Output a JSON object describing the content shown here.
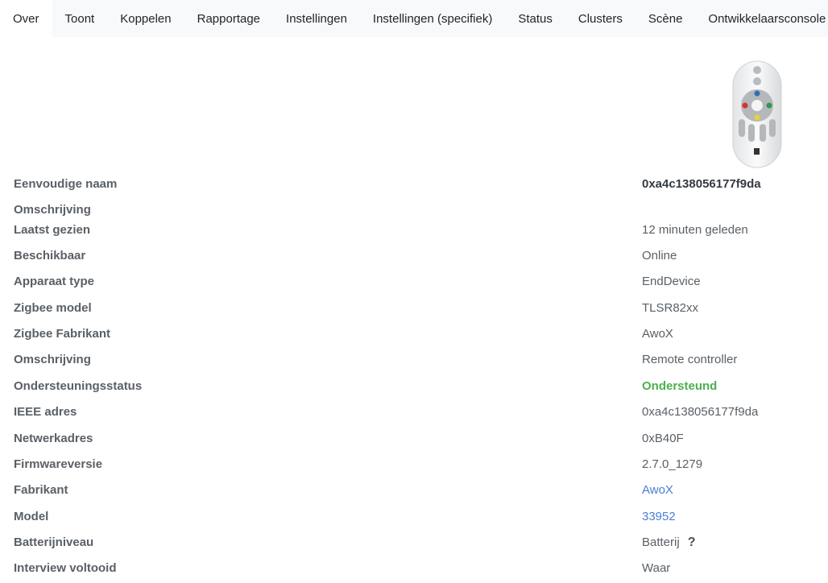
{
  "tabs": [
    {
      "label": "Over"
    },
    {
      "label": "Toont"
    },
    {
      "label": "Koppelen"
    },
    {
      "label": "Rapportage"
    },
    {
      "label": "Instellingen"
    },
    {
      "label": "Instellingen (specifiek)"
    },
    {
      "label": "Status"
    },
    {
      "label": "Clusters"
    },
    {
      "label": "Scène"
    },
    {
      "label": "Ontwikkelaarsconsole"
    }
  ],
  "details": {
    "friendly_name_label": "Eenvoudige naam",
    "friendly_name_value": "0xa4c138056177f9da",
    "description_label": "Omschrijving",
    "last_seen_label": "Laatst gezien",
    "last_seen_value": "12 minuten geleden",
    "availability_label": "Beschikbaar",
    "availability_value": "Online",
    "device_type_label": "Apparaat type",
    "device_type_value": "EndDevice",
    "zigbee_model_label": "Zigbee model",
    "zigbee_model_value": "TLSR82xx",
    "zigbee_manufacturer_label": "Zigbee Fabrikant",
    "zigbee_manufacturer_value": "AwoX",
    "description2_label": "Omschrijving",
    "description2_value": "Remote controller",
    "support_status_label": "Ondersteuningsstatus",
    "support_status_value": "Ondersteund",
    "ieee_label": "IEEE adres",
    "ieee_value": "0xa4c138056177f9da",
    "network_address_label": "Netwerkadres",
    "network_address_value": "0xB40F",
    "firmware_label": "Firmwareversie",
    "firmware_value": "2.7.0_1279",
    "manufacturer_label": "Fabrikant",
    "manufacturer_value": "AwoX",
    "model_label": "Model",
    "model_value": "33952",
    "battery_label": "Batterijniveau",
    "battery_value": "Batterij",
    "battery_help": "?",
    "interview_label": "Interview voltooid",
    "interview_value": "Waar"
  },
  "colors": {
    "success": "#4caf50",
    "link": "#4a7fd4",
    "tab_bar": "#f8f9fa"
  }
}
